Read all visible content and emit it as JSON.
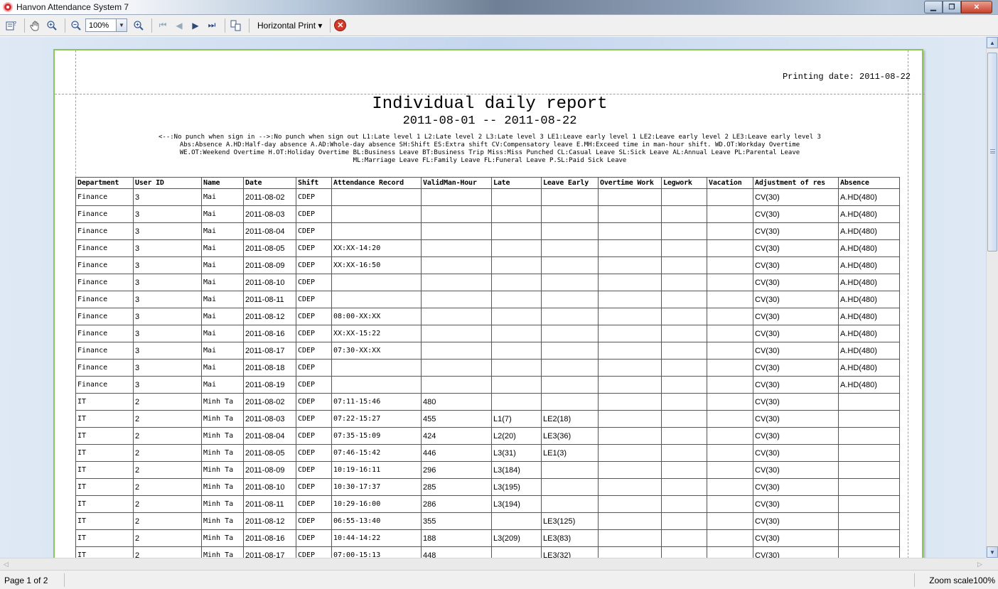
{
  "window": {
    "title": "Hanvon Attendance System 7",
    "min_icon": "minimize-icon",
    "max_icon": "maximize-icon",
    "close_icon": "close-icon"
  },
  "toolbar": {
    "zoom_value": "100%",
    "horizontal_print_label": "Horizontal Print",
    "dropdown_glyph": "▾",
    "icons": [
      "print-setup-icon",
      "hand-pan-icon",
      "zoom-in-icon",
      "zoom-out-icon",
      "zoom-in-icon",
      "first-page-icon",
      "prev-page-icon",
      "next-page-icon",
      "last-page-icon",
      "page-layout-icon",
      "close-report-icon"
    ]
  },
  "report": {
    "printing_date": "Printing date: 2011-08-22",
    "title": "Individual daily report",
    "range": "2011-08-01 -- 2011-08-22",
    "legend_lines": [
      "<--:No punch when sign in   -->:No punch when sign out   L1:Late level 1   L2:Late level 2   L3:Late level 3   LE1:Leave early level 1   LE2:Leave early level 2   LE3:Leave early level 3",
      "Abs:Absence   A.HD:Half-day absence   A.AD:Whole-day absence   SH:Shift   ES:Extra shift   CV:Compensatory leave   E.MH:Exceed time in man-hour shift.   WD.OT:Workday Overtime",
      "WE.OT:Weekend Overtime   H.OT:Holiday Overtime   BL:Business Leave   BT:Business Trip   Miss:Miss Punched   CL:Casual Leave   SL:Sick Leave   AL:Annual Leave   PL:Parental Leave",
      "ML:Marriage Leave   FL:Family Leave   FL:Funeral Leave   P.SL:Paid Sick Leave"
    ],
    "columns": [
      "Department",
      "User ID",
      "Name",
      "Date",
      "Shift",
      "Attendance Record",
      "ValidMan-Hour",
      "Late",
      "Leave Early",
      "Overtime Work",
      "Legwork",
      "Vacation",
      "Adjustment of res",
      "Absence"
    ],
    "rows": [
      [
        "Finance",
        "3",
        "Mai",
        "2011-08-02",
        "CDEP",
        "",
        "",
        "",
        "",
        "",
        "",
        "",
        "CV(30)",
        "A.HD(480)"
      ],
      [
        "Finance",
        "3",
        "Mai",
        "2011-08-03",
        "CDEP",
        "",
        "",
        "",
        "",
        "",
        "",
        "",
        "CV(30)",
        "A.HD(480)"
      ],
      [
        "Finance",
        "3",
        "Mai",
        "2011-08-04",
        "CDEP",
        "",
        "",
        "",
        "",
        "",
        "",
        "",
        "CV(30)",
        "A.HD(480)"
      ],
      [
        "Finance",
        "3",
        "Mai",
        "2011-08-05",
        "CDEP",
        "XX:XX-14:20",
        "",
        "",
        "",
        "",
        "",
        "",
        "CV(30)",
        "A.HD(480)"
      ],
      [
        "Finance",
        "3",
        "Mai",
        "2011-08-09",
        "CDEP",
        "XX:XX-16:50",
        "",
        "",
        "",
        "",
        "",
        "",
        "CV(30)",
        "A.HD(480)"
      ],
      [
        "Finance",
        "3",
        "Mai",
        "2011-08-10",
        "CDEP",
        "",
        "",
        "",
        "",
        "",
        "",
        "",
        "CV(30)",
        "A.HD(480)"
      ],
      [
        "Finance",
        "3",
        "Mai",
        "2011-08-11",
        "CDEP",
        "",
        "",
        "",
        "",
        "",
        "",
        "",
        "CV(30)",
        "A.HD(480)"
      ],
      [
        "Finance",
        "3",
        "Mai",
        "2011-08-12",
        "CDEP",
        "08:00-XX:XX",
        "",
        "",
        "",
        "",
        "",
        "",
        "CV(30)",
        "A.HD(480)"
      ],
      [
        "Finance",
        "3",
        "Mai",
        "2011-08-16",
        "CDEP",
        "XX:XX-15:22",
        "",
        "",
        "",
        "",
        "",
        "",
        "CV(30)",
        "A.HD(480)"
      ],
      [
        "Finance",
        "3",
        "Mai",
        "2011-08-17",
        "CDEP",
        "07:30-XX:XX",
        "",
        "",
        "",
        "",
        "",
        "",
        "CV(30)",
        "A.HD(480)"
      ],
      [
        "Finance",
        "3",
        "Mai",
        "2011-08-18",
        "CDEP",
        "",
        "",
        "",
        "",
        "",
        "",
        "",
        "CV(30)",
        "A.HD(480)"
      ],
      [
        "Finance",
        "3",
        "Mai",
        "2011-08-19",
        "CDEP",
        "",
        "",
        "",
        "",
        "",
        "",
        "",
        "CV(30)",
        "A.HD(480)"
      ],
      [
        "IT",
        "2",
        "Minh Ta",
        "2011-08-02",
        "CDEP",
        "07:11-15:46",
        "480",
        "",
        "",
        "",
        "",
        "",
        "CV(30)",
        ""
      ],
      [
        "IT",
        "2",
        "Minh Ta",
        "2011-08-03",
        "CDEP",
        "07:22-15:27",
        "455",
        "L1(7)",
        "LE2(18)",
        "",
        "",
        "",
        "CV(30)",
        ""
      ],
      [
        "IT",
        "2",
        "Minh Ta",
        "2011-08-04",
        "CDEP",
        "07:35-15:09",
        "424",
        "L2(20)",
        "LE3(36)",
        "",
        "",
        "",
        "CV(30)",
        ""
      ],
      [
        "IT",
        "2",
        "Minh Ta",
        "2011-08-05",
        "CDEP",
        "07:46-15:42",
        "446",
        "L3(31)",
        "LE1(3)",
        "",
        "",
        "",
        "CV(30)",
        ""
      ],
      [
        "IT",
        "2",
        "Minh Ta",
        "2011-08-09",
        "CDEP",
        "10:19-16:11",
        "296",
        "L3(184)",
        "",
        "",
        "",
        "",
        "CV(30)",
        ""
      ],
      [
        "IT",
        "2",
        "Minh Ta",
        "2011-08-10",
        "CDEP",
        "10:30-17:37",
        "285",
        "L3(195)",
        "",
        "",
        "",
        "",
        "CV(30)",
        ""
      ],
      [
        "IT",
        "2",
        "Minh Ta",
        "2011-08-11",
        "CDEP",
        "10:29-16:00",
        "286",
        "L3(194)",
        "",
        "",
        "",
        "",
        "CV(30)",
        ""
      ],
      [
        "IT",
        "2",
        "Minh Ta",
        "2011-08-12",
        "CDEP",
        "06:55-13:40",
        "355",
        "",
        "LE3(125)",
        "",
        "",
        "",
        "CV(30)",
        ""
      ],
      [
        "IT",
        "2",
        "Minh Ta",
        "2011-08-16",
        "CDEP",
        "10:44-14:22",
        "188",
        "L3(209)",
        "LE3(83)",
        "",
        "",
        "",
        "CV(30)",
        ""
      ],
      [
        "IT",
        "2",
        "Minh Ta",
        "2011-08-17",
        "CDEP",
        "07:00-15:13",
        "448",
        "",
        "LE3(32)",
        "",
        "",
        "",
        "CV(30)",
        ""
      ]
    ]
  },
  "statusbar": {
    "page_info": "Page 1 of 2",
    "zoom_scale": "Zoom scale100%"
  }
}
